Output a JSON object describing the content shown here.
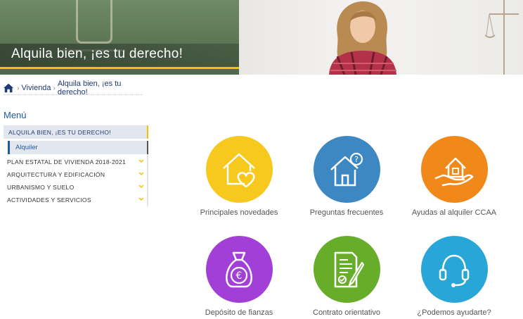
{
  "hero": {
    "title": "Alquila bien, ¡es tu derecho!"
  },
  "breadcrumb": {
    "items": [
      "Vivienda",
      "Alquila bien, ¡es tu derecho!"
    ]
  },
  "menu": {
    "title": "Menú",
    "active_item": "ALQUILA BIEN, ¡ES TU DERECHO!",
    "sub_item": "Alquiler",
    "items": [
      "PLAN ESTATAL DE VIVIENDA 2018-2021",
      "ARQUITECTURA Y EDIFICACIÓN",
      "URBANISMO Y SUELO",
      "ACTIVIDADES Y SERVICIOS"
    ]
  },
  "tiles": [
    {
      "label": "Principales novedades",
      "icon": "house-heart-icon",
      "color": "#f7c81e"
    },
    {
      "label": "Preguntas frecuentes",
      "icon": "house-question-icon",
      "color": "#3d88c2"
    },
    {
      "label": "Ayudas al alquiler CCAA",
      "icon": "hand-house-icon",
      "color": "#f0891a"
    },
    {
      "label": "Depósito de fianzas",
      "icon": "money-bag-icon",
      "color": "#a23fd6"
    },
    {
      "label": "Contrato orientativo",
      "icon": "contract-icon",
      "color": "#68ad2a"
    },
    {
      "label": "¿Podemos ayudarte?",
      "icon": "headset-icon",
      "color": "#29a6d8"
    }
  ],
  "colors": {
    "accent": "#f2c200",
    "link": "#1f3b73",
    "menu_title": "#1f5aa6"
  }
}
